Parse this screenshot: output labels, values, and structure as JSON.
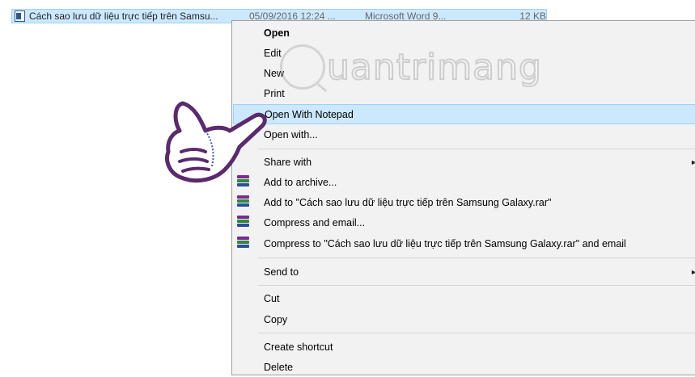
{
  "file_row": {
    "name": "Cách sao lưu dữ liệu trực tiếp trên Samsu...",
    "date": "05/09/2016 12:24 ...",
    "type": "Microsoft Word 9...",
    "size": "12 KB"
  },
  "watermark": {
    "text": "uantrimang"
  },
  "context_menu": {
    "items": [
      {
        "label": "Open"
      },
      {
        "label": "Edit"
      },
      {
        "label": "New"
      },
      {
        "label": "Print"
      },
      {
        "label": "Open With Notepad"
      },
      {
        "label": "Open with..."
      },
      {
        "label": "Share with"
      },
      {
        "label": "Add to archive..."
      },
      {
        "label": "Add to \"Cách sao lưu dữ liệu trực tiếp trên Samsung Galaxy.rar\""
      },
      {
        "label": "Compress and email..."
      },
      {
        "label": "Compress to \"Cách sao lưu dữ liệu trực tiếp trên Samsung Galaxy.rar\" and email"
      },
      {
        "label": "Send to"
      },
      {
        "label": "Cut"
      },
      {
        "label": "Copy"
      },
      {
        "label": "Create shortcut"
      },
      {
        "label": "Delete"
      }
    ],
    "submenu_arrow": "►"
  },
  "icons": {
    "file": "word-document-icon",
    "archive": "winrar-icon",
    "hand": "pointing-hand-icon"
  },
  "colors": {
    "selection": "#cce8ff",
    "selection_border": "#99d1ff",
    "menu_bg": "#f2f2f2",
    "hand_fill": "#ffffff",
    "hand_stroke": "#5a2a6e"
  }
}
